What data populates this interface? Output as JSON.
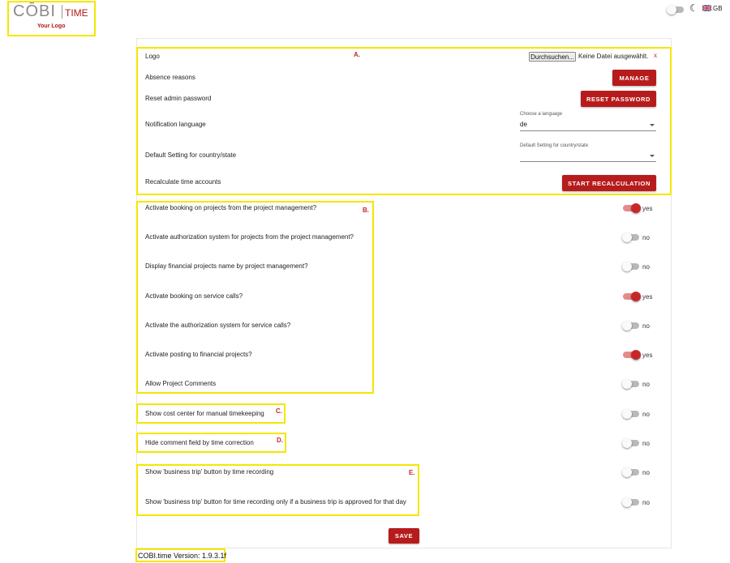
{
  "header": {
    "logo_text_main": "CŌBI",
    "logo_text_time": "TIME",
    "logo_tagline": "Your Logo",
    "language": "GB",
    "moon_icon": "moon-icon",
    "flag_icon": "uk-flag-icon"
  },
  "settings": {
    "logo_label": "Logo",
    "file_button": "Durchsuchen...",
    "file_status": "Keine Datei ausgewählt.",
    "file_clear": "x",
    "absence_label": "Absence reasons",
    "manage_button": "Manage",
    "reset_label": "Reset admin password",
    "reset_button": "Reset password",
    "notification_label": "Notification language",
    "language_select_label": "Choose a language",
    "language_select_value": "de",
    "country_label": "Default Setting for country/state",
    "country_select_label": "Default Setting for country/state",
    "country_select_value": "",
    "recalc_label": "Recalculate time accounts",
    "recalc_button": "Start recalculation"
  },
  "annotations": {
    "a": "A.",
    "b": "B.",
    "c": "C.",
    "d": "D.",
    "e": "E."
  },
  "toggles": [
    {
      "label": "Activate booking on projects from the project management?",
      "on": true,
      "state": "yes"
    },
    {
      "label": "Activate authorization system for projects from the project management?",
      "on": false,
      "state": "no"
    },
    {
      "label": "Display financial projects name by project management?",
      "on": false,
      "state": "no"
    },
    {
      "label": "Activate booking on service calls?",
      "on": true,
      "state": "yes"
    },
    {
      "label": "Activate the authorization system for service calls?",
      "on": false,
      "state": "no"
    },
    {
      "label": "Activate posting to financial projects?",
      "on": true,
      "state": "yes"
    },
    {
      "label": "Allow Project Comments",
      "on": false,
      "state": "no"
    },
    {
      "label": "Show cost center for manual timekeeping",
      "on": false,
      "state": "no"
    },
    {
      "label": "Hide comment field by time correction",
      "on": false,
      "state": "no"
    },
    {
      "label": "Show 'business trip' button by time recording",
      "on": false,
      "state": "no"
    },
    {
      "label": "Show 'business trip' button for time recording only if a business trip is approved for that day",
      "on": false,
      "state": "no"
    }
  ],
  "save_button": "Save",
  "version": "COBI.time Version: 1.9.3.1f"
}
